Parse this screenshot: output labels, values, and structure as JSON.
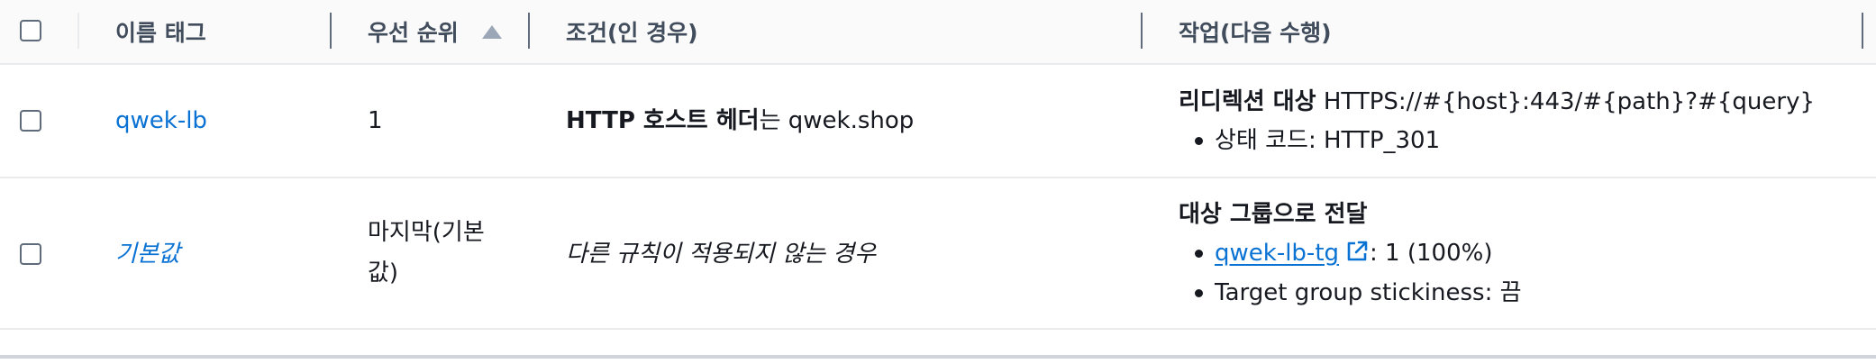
{
  "header": {
    "col_name": "이름 태그",
    "col_priority": "우선 순위",
    "col_condition": "조건(인 경우)",
    "col_action": "작업(다음 수행)"
  },
  "rows": [
    {
      "name": "qwek-lb",
      "priority": "1",
      "condition_bold": "HTTP 호스트 헤더",
      "condition_rest": "는 qwek.shop",
      "action_title_bold": "리디렉션 대상",
      "action_title_rest": " HTTPS://#{host}:443/#{path}?#{query}",
      "action_items": [
        "상태 코드: HTTP_301"
      ]
    },
    {
      "name": "기본값",
      "priority_line1": "마지막(기본",
      "priority_line2": "값)",
      "condition": "다른 규칙이 적용되지 않는 경우",
      "action_title_bold": "대상 그룹으로 전달",
      "target_group_link": "qwek-lb-tg",
      "target_group_weight": ": 1 (100%)",
      "stickiness": "Target group stickiness: 끔"
    }
  ],
  "colors": {
    "link": "#0972d3",
    "header_text": "#414d5c",
    "divider": "#e9ebed"
  },
  "icons": {
    "sort": "caret-up-icon",
    "external": "external-link-icon"
  }
}
